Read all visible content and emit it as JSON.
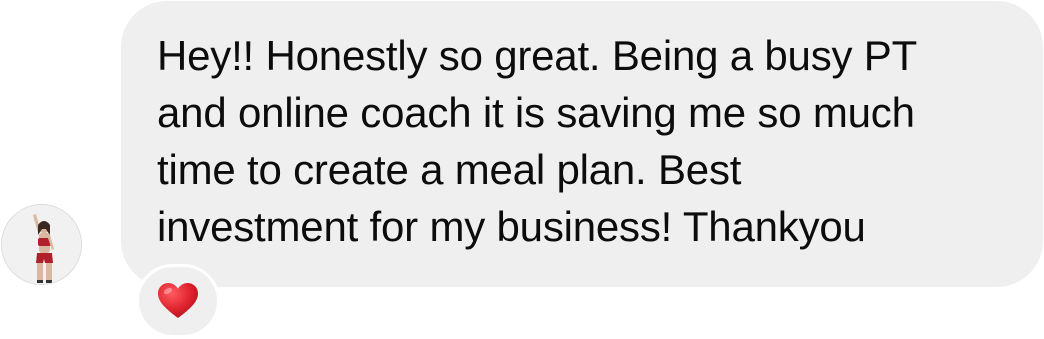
{
  "message": {
    "lines": [
      "Hey!! Honestly so great. Being a busy PT",
      "and online coach it is saving me so much",
      "time to create a meal plan. Best",
      "investment for my business! Thankyou"
    ]
  },
  "sender": {
    "avatar_icon": "profile-photo-avatar"
  },
  "reaction": {
    "icon": "red-heart-icon",
    "color": "#e0242f"
  },
  "colors": {
    "bubble": "#efeff0",
    "text": "#0c0c0c"
  }
}
